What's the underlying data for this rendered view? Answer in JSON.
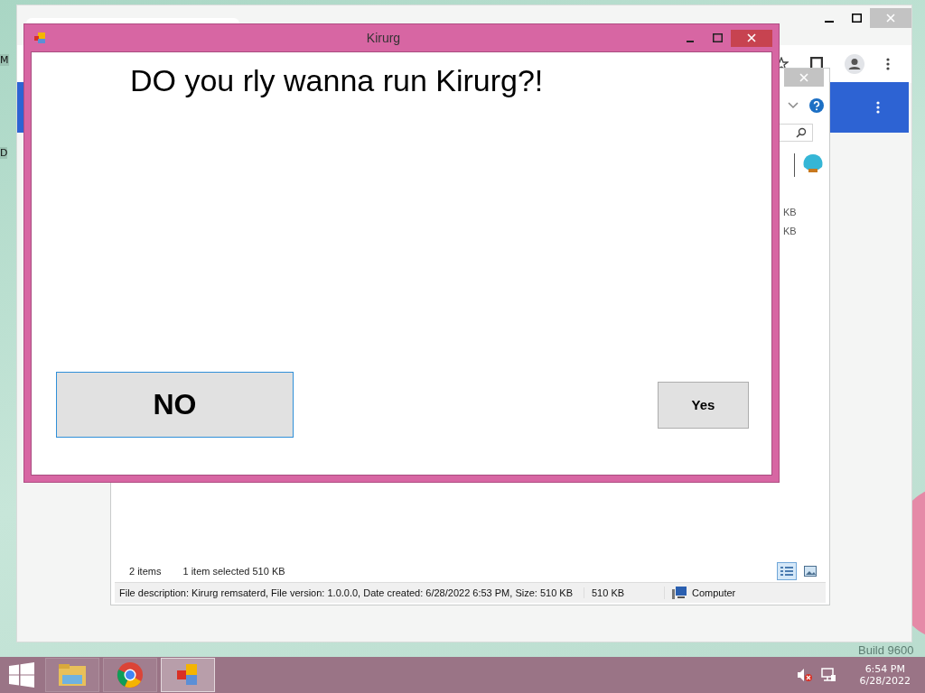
{
  "desktop": {
    "edge_labels": [
      "M",
      "D"
    ],
    "watermark_fragment": "Build 9600"
  },
  "explorer": {
    "size_column": [
      "KB",
      "KB"
    ],
    "status": {
      "items": "2 items",
      "selection": "1 item selected  510 KB"
    },
    "details": {
      "description": "File description: Kirurg remsaterd, File version: 1.0.0.0, Date created: 6/28/2022 6:53 PM, Size: 510 KB",
      "size": "510 KB",
      "zone": "Computer"
    },
    "views": [
      {
        "selected": true
      },
      {
        "selected": false
      }
    ]
  },
  "dialog": {
    "title": "Kirurg",
    "heading": "DO you rly wanna run Kirurg?!",
    "buttons": [
      {
        "label": "NO",
        "focused": true
      },
      {
        "label": "Yes",
        "focused": false
      }
    ]
  },
  "taskbar": {
    "apps": [
      {
        "kind": "folder",
        "selected": false
      },
      {
        "kind": "browser",
        "selected": false
      },
      {
        "kind": "app",
        "selected": true
      }
    ],
    "time": "6:54 PM",
    "date": "6/28/2022"
  }
}
